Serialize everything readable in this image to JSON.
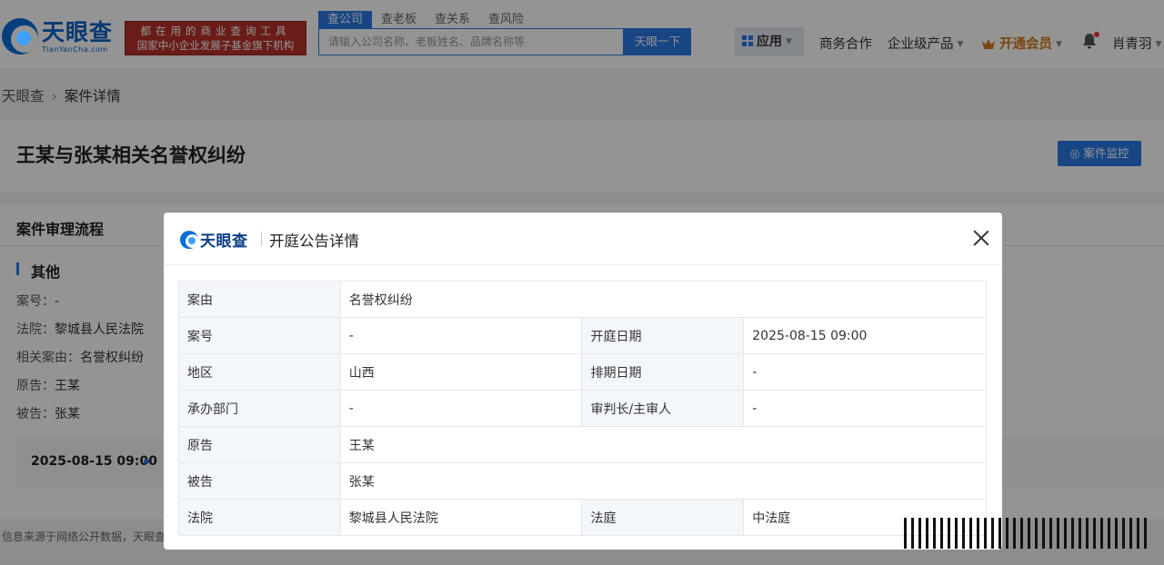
{
  "header": {
    "logo_cn": "天眼查",
    "logo_en": "TianYanCha.com",
    "slogan_line1": "都在用的商业查询工具",
    "slogan_line2": "国家中小企业发展子基金旗下机构",
    "search_tabs": [
      "查公司",
      "查老板",
      "查关系",
      "查风险"
    ],
    "search_placeholder": "请输入公司名称、老板姓名、品牌名称等",
    "search_button": "天眼一下",
    "nav_apps": "应用",
    "nav_business": "商务合作",
    "nav_enterprise": "企业级产品",
    "nav_vip": "开通会员",
    "user_name": "肖青羽",
    "accent_color": "#2a78e4"
  },
  "breadcrumb": {
    "home": "天眼查",
    "current": "案件详情"
  },
  "case": {
    "title": "王某与张某相关名誉权纠纷",
    "monitor_button": "案件监控"
  },
  "flow": {
    "section_title": "案件审理流程",
    "stage_title": "其他",
    "rows": [
      {
        "key": "案号：",
        "value": "-"
      },
      {
        "key": "法院：",
        "value": "黎城县人民法院"
      },
      {
        "key": "相关案由：",
        "value": "名誉权纠纷"
      },
      {
        "key": "原告：",
        "value": "王某"
      },
      {
        "key": "被告：",
        "value": "张某"
      }
    ],
    "timeline_time": "2025-08-15 09:00"
  },
  "footer_note": "信息来源于网络公开数据，天眼查",
  "modal": {
    "logo": "天眼查",
    "title": "开庭公告详情",
    "rows": {
      "cause_label": "案由",
      "cause_value": "名誉权纠纷",
      "case_no_label": "案号",
      "case_no_value": "-",
      "hearing_date_label": "开庭日期",
      "hearing_date_value": "2025-08-15 09:00",
      "region_label": "地区",
      "region_value": "山西",
      "schedule_date_label": "排期日期",
      "schedule_date_value": "-",
      "dept_label": "承办部门",
      "dept_value": "-",
      "judge_label": "审判长/主审人",
      "judge_value": "-",
      "plaintiff_label": "原告",
      "plaintiff_value": "王某",
      "defendant_label": "被告",
      "defendant_value": "张某",
      "court_label": "法院",
      "court_value": "黎城县人民法院",
      "courtroom_label": "法庭",
      "courtroom_value": "中法庭"
    }
  }
}
